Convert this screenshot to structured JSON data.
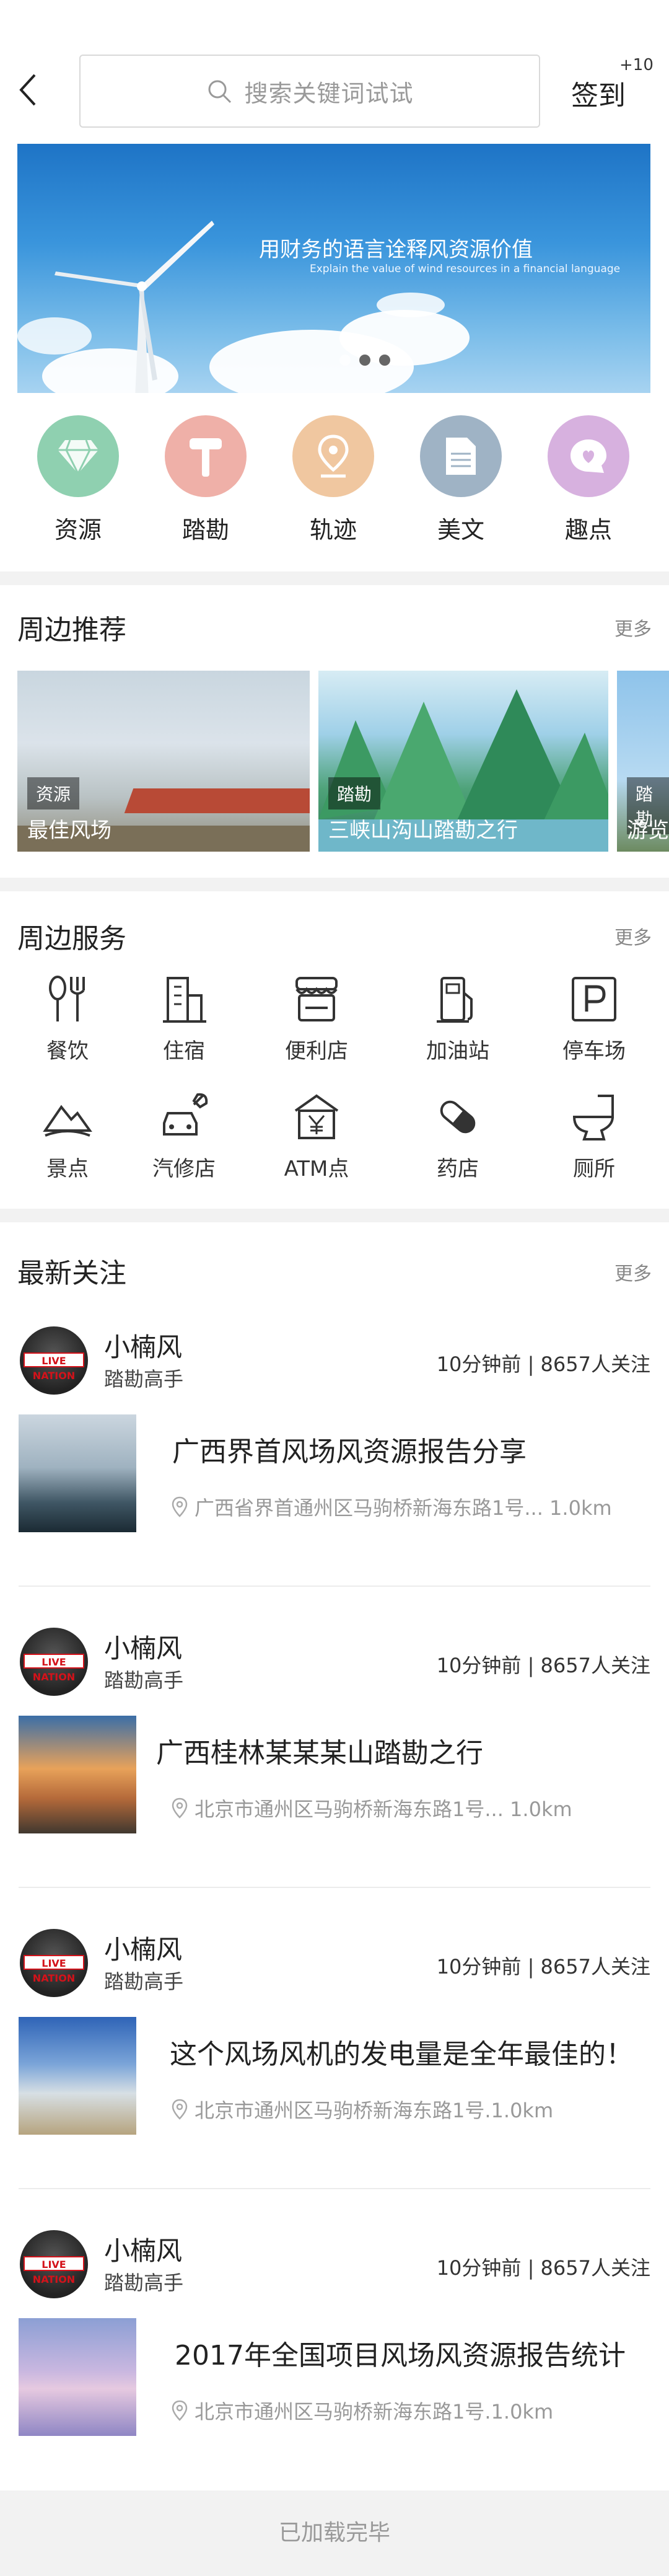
{
  "header": {
    "search_placeholder": "搜索关键词试试",
    "signin_label": "签到",
    "signin_bonus": "+10"
  },
  "banner": {
    "title": "用财务的语言诠释风资源价值",
    "subtitle": "Explain the value of wind resources in a financial language",
    "slide_count": 3,
    "active_slide": 1
  },
  "categories": [
    {
      "label": "资源",
      "icon": "diamond-icon",
      "color": "#8fd0b0"
    },
    {
      "label": "踏勘",
      "icon": "hammer-icon",
      "color": "#efb0a8"
    },
    {
      "label": "轨迹",
      "icon": "location-pin-icon",
      "color": "#f0c7a0"
    },
    {
      "label": "美文",
      "icon": "document-icon",
      "color": "#9fb3c5"
    },
    {
      "label": "趣点",
      "icon": "heart-chat-icon",
      "color": "#d7b1df"
    }
  ],
  "nearby": {
    "title": "周边推荐",
    "more": "更多",
    "items": [
      {
        "tag": "资源",
        "caption": "最佳风场"
      },
      {
        "tag": "踏勘",
        "caption": "三峡山沟山踏勘之行"
      },
      {
        "tag": "踏勘",
        "caption": "游览"
      }
    ]
  },
  "services": {
    "title": "周边服务",
    "more": "更多",
    "items": [
      {
        "label": "餐饮",
        "icon": "fork-knife-icon"
      },
      {
        "label": "住宿",
        "icon": "building-icon"
      },
      {
        "label": "便利店",
        "icon": "shop-icon"
      },
      {
        "label": "加油站",
        "icon": "gas-pump-icon"
      },
      {
        "label": "停车场",
        "icon": "parking-icon"
      },
      {
        "label": "景点",
        "icon": "mountain-icon"
      },
      {
        "label": "汽修店",
        "icon": "car-wrench-icon"
      },
      {
        "label": "ATM点",
        "icon": "atm-bank-icon"
      },
      {
        "label": "药店",
        "icon": "pill-icon"
      },
      {
        "label": "厕所",
        "icon": "toilet-icon"
      }
    ]
  },
  "feed": {
    "title": "最新关注",
    "more": "更多",
    "avatar_text": "LIVE NATION",
    "items": [
      {
        "user": "小楠风",
        "role": "踏勘高手",
        "time": "10分钟前",
        "sep": "|",
        "followers": "8657人关注",
        "title": "广西界首风场风资源报告分享",
        "location": "广西省界首通州区马驹桥新海东路1号...  1.0km"
      },
      {
        "user": "小楠风",
        "role": "踏勘高手",
        "time": "10分钟前",
        "sep": "|",
        "followers": "8657人关注",
        "title": "广西桂林某某某山踏勘之行",
        "location": "北京市通州区马驹桥新海东路1号...   1.0km"
      },
      {
        "user": "小楠风",
        "role": "踏勘高手",
        "time": "10分钟前",
        "sep": "|",
        "followers": "8657人关注",
        "title": "这个风场风机的发电量是全年最佳的！",
        "location": "北京市通州区马驹桥新海东路1号.1.0km"
      },
      {
        "user": "小楠风",
        "role": "踏勘高手",
        "time": "10分钟前",
        "sep": "|",
        "followers": "8657人关注",
        "title": "2017年全国项目风场风资源报告统计",
        "location": "北京市通州区马驹桥新海东路1号.1.0km"
      }
    ]
  },
  "footer": {
    "text": "已加载完毕"
  }
}
